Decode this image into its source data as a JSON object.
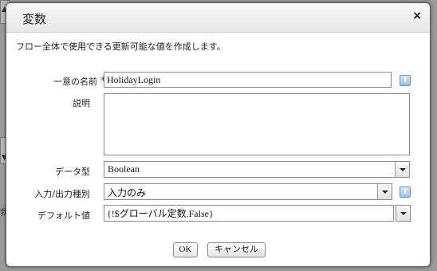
{
  "dialog": {
    "title": "変数",
    "close_glyph": "×",
    "description": "フロー全体で使用できる更新可能な値を作成します。"
  },
  "form": {
    "unique_name": {
      "label": "一意の名前",
      "required_mark": "*",
      "value": "HolidayLogin"
    },
    "description": {
      "label": "説明",
      "value": ""
    },
    "data_type": {
      "label": "データ型",
      "value": "Boolean"
    },
    "io_type": {
      "label": "入力/出力種別",
      "value": "入力のみ"
    },
    "default_value": {
      "label": "デフォルト値",
      "value": "{!$グローバル定数.False}"
    },
    "info_glyph": "i"
  },
  "buttons": {
    "ok": "OK",
    "cancel": "キャンセル"
  },
  "background": {
    "edge_glyphs": [
      "▲",
      "▼",
      "我"
    ]
  }
}
